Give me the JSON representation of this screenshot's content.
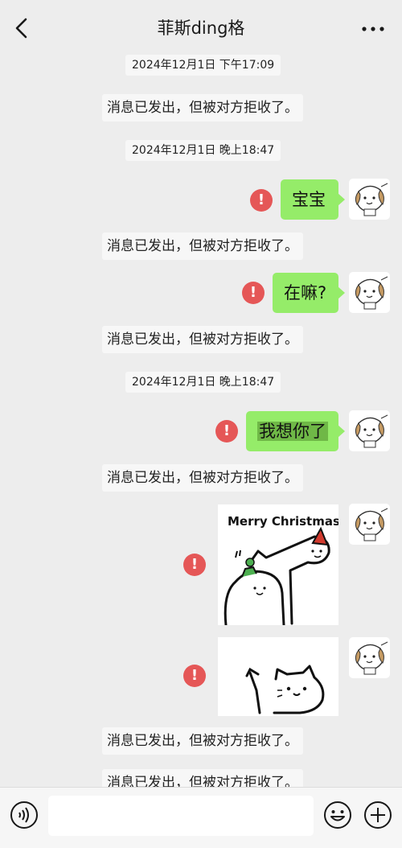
{
  "header": {
    "title": "菲斯ding格",
    "back_icon": "chevron-left-icon",
    "more_icon": "more-dots-icon"
  },
  "messages": {
    "time1": "2024年12月1日 下午17:09",
    "sys1": "消息已发出，但被对方拒收了。",
    "time2": "2024年12月1日 晚上18:47",
    "bubble1": "宝宝",
    "sys2": "消息已发出，但被对方拒收了。",
    "bubble2": "在嘛?",
    "sys3": "消息已发出，但被对方拒收了。",
    "time3": "2024年12月1日 晚上18:47",
    "bubble3": "我想你了",
    "sys4": "消息已发出，但被对方拒收了。",
    "sticker1_text": "Merry Christmas",
    "sys5": "消息已发出，但被对方拒收了。",
    "sys6": "消息已发出，但被对方拒收了。"
  },
  "input": {
    "voice_icon": "voice-icon",
    "emoji_icon": "emoji-icon",
    "plus_icon": "plus-icon"
  },
  "colors": {
    "background": "#ededed",
    "bubble_green": "#95ec69",
    "error_red": "#e55757"
  }
}
